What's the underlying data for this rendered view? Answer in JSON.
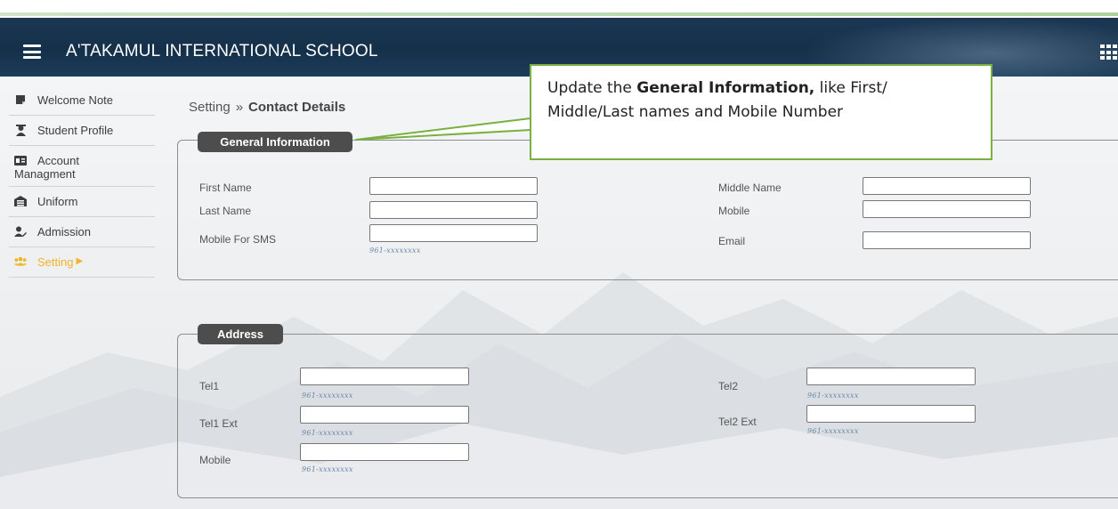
{
  "header": {
    "school_name": "A'TAKAMUL INTERNATIONAL SCHOOL"
  },
  "sidebar": {
    "items": [
      {
        "label": "Welcome Note",
        "icon": "note-icon"
      },
      {
        "label": "Student Profile",
        "icon": "student-icon"
      },
      {
        "label_line1": "Account",
        "label_line2": "Managment",
        "icon": "id-card-icon"
      },
      {
        "label": "Uniform",
        "icon": "warehouse-icon"
      },
      {
        "label": "Admission",
        "icon": "user-edit-icon"
      },
      {
        "label": "Setting",
        "icon": "users-icon",
        "active": true
      }
    ]
  },
  "breadcrumb": {
    "parent": "Setting",
    "separator": "»",
    "current": "Contact Details"
  },
  "general_info": {
    "legend": "General Information",
    "first_name_label": "First Name",
    "last_name_label": "Last Name",
    "mobile_sms_label": "Mobile For SMS",
    "mobile_sms_hint": "961-xxxxxxxx",
    "middle_name_label": "Middle Name",
    "mobile_label": "Mobile",
    "email_label": "Email"
  },
  "address": {
    "legend": "Address",
    "tel1_label": "Tel1",
    "tel1_ext_label": "Tel1 Ext",
    "mobile_label": "Mobile",
    "tel2_label": "Tel2",
    "tel2_ext_label": "Tel2 Ext",
    "hint": "961-xxxxxxxx"
  },
  "callout": {
    "text_prefix": "Update the ",
    "text_bold": "General Information,",
    "text_line1_suffix": " like First/",
    "text_line2": "Middle/Last names and Mobile Number"
  },
  "colors": {
    "header_bg": "#14304a",
    "active_item": "#f0b429",
    "legend_bg": "#4d4d4d",
    "callout_border": "#78b13f"
  }
}
